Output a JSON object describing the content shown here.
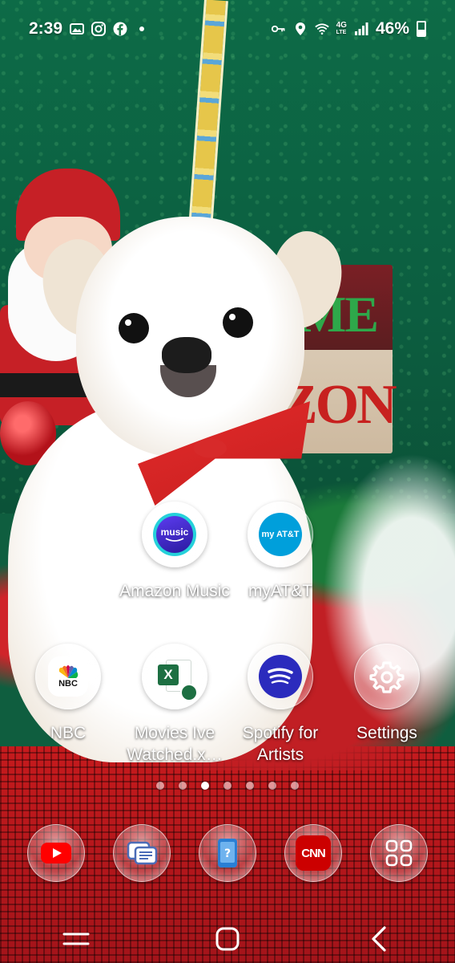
{
  "status_bar": {
    "time": "2:39",
    "network": "4G",
    "network_sub": "LTE",
    "battery": "46%"
  },
  "apps_row1": [
    {
      "name": "amazon-music",
      "label": "Amazon Music",
      "icon_text": "music",
      "color": "#232f3e"
    },
    {
      "name": "myatt",
      "label": "myAT&T",
      "icon_text": "my AT&T",
      "color": "#009fdb"
    }
  ],
  "apps_row2": [
    {
      "name": "nbc",
      "label": "NBC",
      "icon_text": "NBC"
    },
    {
      "name": "movies-ive-watched",
      "label": "Movies Ive Watched.x…",
      "icon_text": "X"
    },
    {
      "name": "spotify-for-artists",
      "label": "Spotify for Artists"
    },
    {
      "name": "settings",
      "label": "Settings"
    }
  ],
  "page_indicator": {
    "count": 7,
    "active": 3
  },
  "dock": [
    {
      "name": "youtube",
      "color": "#ff0000"
    },
    {
      "name": "messages",
      "color": "#4b6cb7"
    },
    {
      "name": "samsung-members",
      "color": "#2a7fd4"
    },
    {
      "name": "cnn",
      "icon_text": "CNN",
      "color": "#cc0000"
    },
    {
      "name": "app-drawer"
    }
  ],
  "wallpaper_text": {
    "sign_top": "ME",
    "sign_bottom": "ZON"
  }
}
